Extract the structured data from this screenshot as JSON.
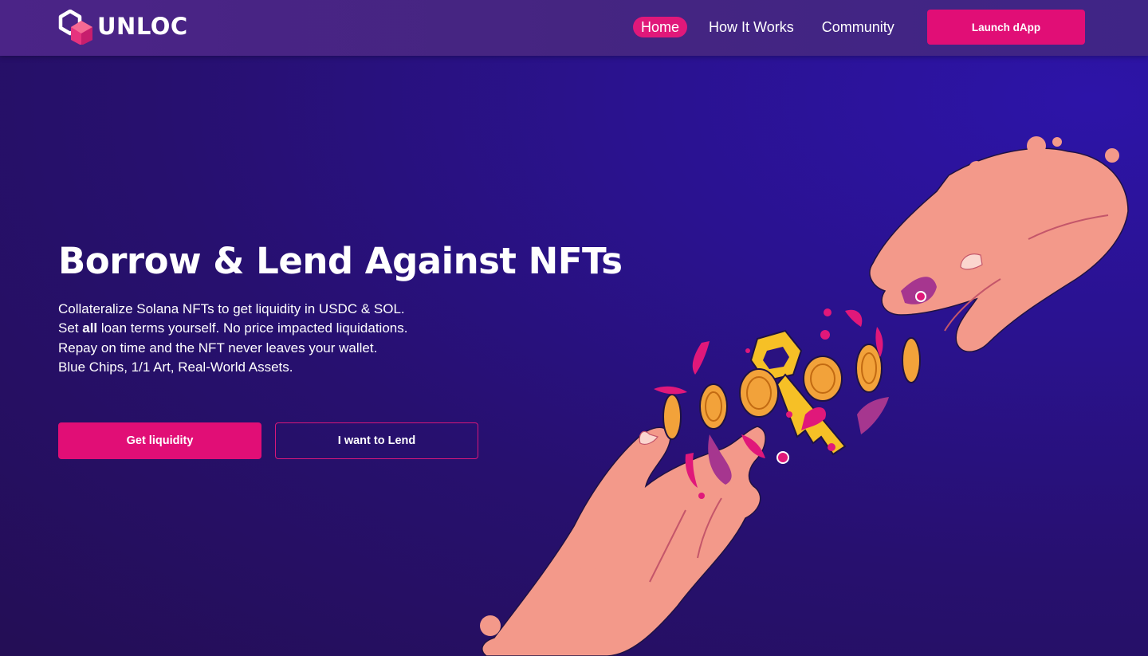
{
  "header": {
    "logo": {
      "text": "UNLOC",
      "icon": "unloc-hexagon-logo-icon"
    },
    "nav": [
      {
        "label": "Home",
        "active": true
      },
      {
        "label": "How It Works",
        "active": false
      },
      {
        "label": "Community",
        "active": false
      }
    ],
    "launch_label": "Launch dApp"
  },
  "hero": {
    "title": "Borrow & Lend Against NFTs",
    "lines": [
      "Collateralize Solana NFTs to get liquidity in USDC & SOL.",
      {
        "before": "Set ",
        "bold": "all",
        "after": " loan terms yourself.  No price impacted liquidations."
      },
      "Repay on time and the NFT never leaves your wallet.",
      "Blue Chips, 1/1 Art, Real-World Assets."
    ],
    "primary_cta": "Get liquidity",
    "secondary_cta": "I want to Lend"
  },
  "colors": {
    "accent": "#e10e76",
    "nav_bar": "#452581",
    "background": "#27106f",
    "skin": "#f3998a",
    "coin": "#f2a23a",
    "key": "#f6c026"
  },
  "illustration": {
    "name": "hands-exchanging-key-and-coins-illustration"
  }
}
